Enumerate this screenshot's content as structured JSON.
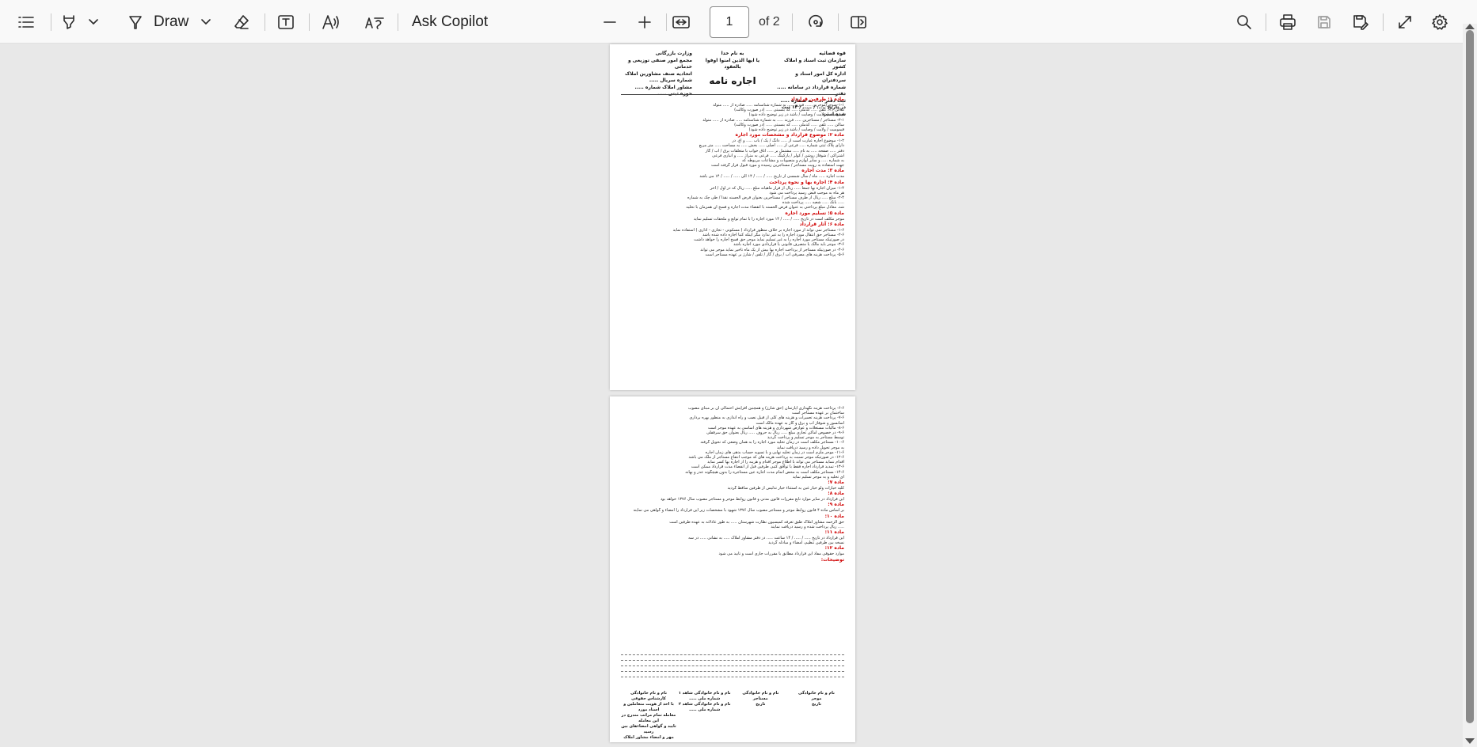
{
  "toolbar": {
    "draw_label": "Draw",
    "ask_copilot_label": "Ask Copilot",
    "page_number": "1",
    "page_total": "of 2"
  },
  "document": {
    "p1_header_right": [
      "قوه قضائیه",
      "سازمان ثبت اسناد و املاک کشور",
      "اداره کل امور اسناد و سردفتران",
      "شماره قرارداد در سامانه ..... دفتر",
      "ثبت دفتر ..... به شماره .....",
      "در تاریخ ..... / ..... / ۱۴ ثبت شده است"
    ],
    "p1_header_center": [
      "به نام خدا",
      "یا ایها الذین امنوا اوفوا بالعقود"
    ],
    "p1_title": "اجاره نامه",
    "p1_header_left": [
      "وزارت بازرگانی",
      "مجمع امور صنفی توزیعی و خدماتی",
      "اتحادیه صنف مشاورین املاک",
      "شماره سریال .....",
      "مشاور املاک شماره .....",
      "حوزه ثبتی ....."
    ],
    "p1_body": [
      {
        "h": "ماده ۱: طرفین قرارداد"
      },
      {
        "l": "۱-۱- موجر/موجرین ..... فرزند ..... به شماره شناسنامه ..... صادره از ..... متولد"
      },
      {
        "l": "ساکن ..... تلفن ..... کدملی ..... که بنسبتی ..... (در صورت وکالت)"
      },
      {
        "l": "قیمومیت / ولایت / وصایت / باشد در زیر توضیح داده شود)"
      },
      {
        "l": "۲-۱- مستاجر / مستاجرین ..... فرزند ..... به شماره شناسنامه ..... صادره از ..... متولد"
      },
      {
        "l": "ساکن ..... تلفن ..... کدملی ..... که بنسبتی ..... (در صورت وکالت)"
      },
      {
        "l": "قیمومیت / ولایت / وصایت / باشد در زیر توضیح داده شود)"
      },
      {
        "h": "ماده ۲: موضوع قرارداد و مشخصات مورد اجاره"
      },
      {
        "l": "۱-۲- موضوع اجاره عبارت است از ..... دانگ / یک / باب ..... و اع. در"
      },
      {
        "l": "دارای پلاک ثبتی شماره ..... فرعی از ..... اصلی ..... بخش ..... به مساحت ..... متر مربع"
      },
      {
        "l": "دفتر ..... صفحه ..... به نام ..... مشتمل بر ..... اتاق خواب با متعلقات برق / آب / گاز"
      },
      {
        "l": "اشتراکی / شوفاژ روشن / کولر / پارکینگ ..... فرعی به متراژ ..... و انباری فرعی"
      },
      {
        "l": "به شماره ..... و سایر لوازم و منصوبات و مشاعات مربوطه که"
      },
      {
        "l": "جهت استفاده به رویت مستاجر / مستاجرین رسیده و مورد قبول قرار گرفته است"
      },
      {
        "h": "ماده ۳: مدت اجاره"
      },
      {
        "l": "مدت اجاره ..... ماه / سال شمسی از تاریخ ..... / ..... / ۱۴ الی ..... / ..... / ۱۴ می باشد"
      },
      {
        "h": "ماده ۴: اجاره بها و نحوه پرداخت"
      },
      {
        "l": "۱-۴- میزان اجاره بها جمعا ..... ریال از قرار ماهیانه مبلغ ..... ریال که در اول / آخر"
      },
      {
        "l": "هر ماه به موجب قبض رسید پرداخت می شود"
      },
      {
        "l": "۲-۴- مبلغ ..... ریال از طرف مستاجر / مستاجرین بعنوان قرض الحسنه نقدا / طی چک به شماره"
      },
      {
        "l": "..... بانک ..... شعبه ..... پرداخت شده"
      },
      {
        "l": "شد. معادل مبلغ پرداختی به عنوان قرض الحسنه با انقضاء مدت اجاره و فسخ آن همزمان با تخلیه"
      },
      {
        "h": "ماده ۵: تسلیم مورد اجاره"
      },
      {
        "l": "موجر مکلف است در تاریخ ..... / ..... / ۱۴ مورد اجاره را با تمام توابع و ملحقات تسلیم نماید"
      },
      {
        "h": "ماده ۶: آثار قرارداد"
      },
      {
        "l": "۱-۶- مستاجر نمی تواند از مورد اجاره بر خلاف منظور قرارداد ( مسکونی - تجاری - اداری ) استفاده نماید"
      },
      {
        "l": "۲-۶- مستاجر حق انتقال مورد اجاره را به غیر ندارد مگر اینکه کتبا اجازه داده شده باشد"
      },
      {
        "l": "در صورتیکه مستاجر مورد اجاره را به غیر تسلیم نماید موجر حق فسخ اجاره را خواهد داشت"
      },
      {
        "l": "۳-۶- موجر باید مالک یا متصرف قانونی یا قراردادی مورد اجاره باشد"
      },
      {
        "l": "۴-۶- در صورتیکه مستاجر از پرداخت اجاره بها بیش از یک ماه تاخیر نماید موجر می تواند"
      },
      {
        "l": "۵-۶- پرداخت هزینه های مصرفی آب / برق / گاز / تلفن / شارژ بر عهده مستاجر است"
      }
    ],
    "p2_body": [
      {
        "l": "۶-۶- پرداخت هزینه نگهداری آپارتمان (حق شارژ) و همچنین افزایش احتمالی آن بر مبنای مصوب"
      },
      {
        "l": "ساختمان بر عهده مستاجر است"
      },
      {
        "l": "۷-۶- پرداخت هزینه تعمیرات و هزینه های کلی از قبیل نصب و راه اندازی به منظور بهره برداری"
      },
      {
        "l": "آسانسور و شوفاژ آب و برق و گاز به عهده مالک است"
      },
      {
        "l": "۸-۶- مالیات مستغلات و عوارض شهرداری و هزینه های اساسی به عهده موجر است"
      },
      {
        "l": "۹-۶- در خصوص اماکن تجاری مبلغ ..... ریال به حروف ..... ریال بعنوان حق سرقفلی"
      },
      {
        "l": "توسط مستاجر به موجر تسلیم و پرداخت گردید"
      },
      {
        "l": "۱۰-۶- مستاجر مکلف است در زمان تخلیه مورد اجاره را به همان وضعی که تحویل گرفته"
      },
      {
        "l": "به موجر تحویل داده و رسید دریافت نماید"
      },
      {
        "l": "۱۱-۶- موجر ملزم است در زمان تخلیه نهایی و با تسویه حساب بدهی های زمان اجاره"
      },
      {
        "l": "۱۲-۶- در صورتیکه موجر نسبت به پرداخت هزینه های که موجب انتفاع مستاجر از ملک می باشد"
      },
      {
        "l": "اقدام ننماید مستاجر می تواند با اطلاع موجر اقدام و هزینه را از اجاره بها کسر نماید"
      },
      {
        "l": "۱۳-۶- تمدید قرارداد اجاره فقط با توافق کتبی طرفین قبل از انقضاء مدت قرارداد ممکن است"
      },
      {
        "l": "۱۴-۶- مستاجر مکلف است به محض اتمام مدت اجاره عین مستاجره را بدون هیچگونه عذر و بهانه"
      },
      {
        "l": "ای تخلیه و به موجر تسلیم نماید"
      },
      {
        "h": "ماده ۷:"
      },
      {
        "l": "کلیه خیارات ولو خیار غبن به استثناء خیار تدلیس از طرفین ساقط گردید"
      },
      {
        "h": "ماده ۸:"
      },
      {
        "l": "این قرارداد در سایر موارد تابع مقررات قانون مدنی و قانون روابط موجر و مستاجر مصوب سال ۱۳۷۶ خواهد بود"
      },
      {
        "h": "ماده ۹:"
      },
      {
        "l": "بر اساس ماده ۴ قانون روابط موجر و مستاجر مصوب سال ۱۳۷۶ شهود با مشخصات زیر این قرارداد را امضاء و گواهی می نمایند"
      },
      {
        "h": "ماده ۱۰:"
      },
      {
        "l": "حق الزحمه مشاور املاک طبق تعرفه کمیسیون نظارت شهرستان ..... به طور عادلانه به عهده طرفین است"
      },
      {
        "l": "..... ریال پرداخت شده و رسید دریافت نمایند"
      },
      {
        "h": "ماده ۱۱:"
      },
      {
        "l": "این قرارداد در تاریخ ..... / ..... / ۱۴ ساعت ..... در دفتر مشاور املاک ..... به نشانی ..... در سه"
      },
      {
        "l": "نسخه بین طرفین تنظیم، امضاء و مبادله گردید"
      },
      {
        "h": "ماده ۱۲:"
      },
      {
        "l": "موارد حقوقی مفاد این قرارداد مطابق با مقررات جاری است و تابید می شود"
      },
      {
        "h": "توضیحات:"
      }
    ],
    "p2_signatures": [
      [
        "نام و نام خانوادگی",
        "موجر",
        "تاریخ"
      ],
      [
        "نام و نام خانوادگی",
        "مستاجر",
        "تاریخ"
      ],
      [
        "نام و نام خانوادگی شاهد ۱",
        "شماره ملی .....",
        "نام و نام خانوادگی شاهد ۲",
        "شماره ملی ....."
      ],
      [
        "نام و نام خانوادگی کارشناس حقوقی",
        "با اخذ از هویت متعاملین و اسناد مورد",
        "معامله تمام مراتب مندرج در این معامله",
        "تایید و گواهی امضاءهای بین رسید",
        "مهر و امضاء مشاور املاک"
      ]
    ]
  }
}
